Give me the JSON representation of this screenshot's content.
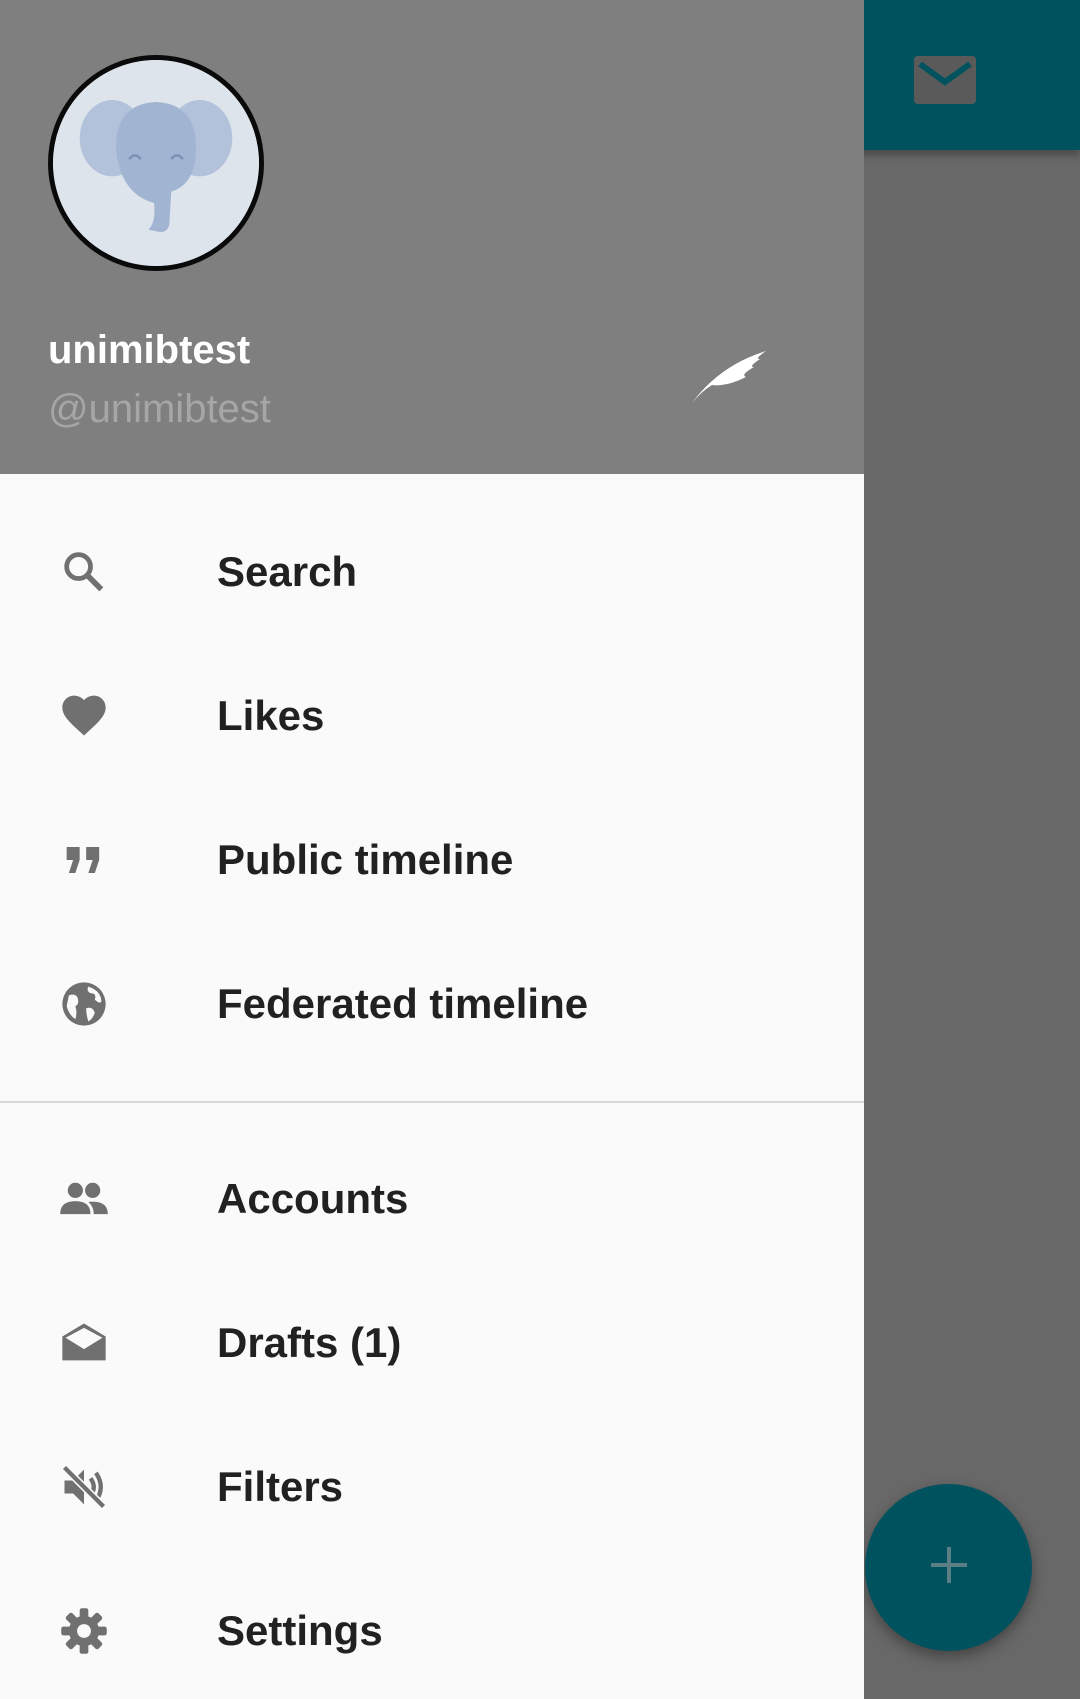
{
  "background": {
    "toolbar_color": "#01525f",
    "mail_icon": "mail-icon",
    "fab_icon": "plus-icon"
  },
  "drawer": {
    "header": {
      "background_color": "#7f7f7f",
      "display_name": "unimibtest",
      "handle": "@unimibtest",
      "avatar_icon": "elephant-avatar",
      "edit_icon": "quill-icon"
    },
    "menu_primary": [
      {
        "icon": "search-icon",
        "label": "Search"
      },
      {
        "icon": "heart-icon",
        "label": "Likes"
      },
      {
        "icon": "quote-icon",
        "label": "Public timeline"
      },
      {
        "icon": "globe-icon",
        "label": "Federated timeline"
      }
    ],
    "menu_secondary": [
      {
        "icon": "people-icon",
        "label": "Accounts"
      },
      {
        "icon": "drafts-icon",
        "label": "Drafts (1)"
      },
      {
        "icon": "volume-off-icon",
        "label": "Filters"
      },
      {
        "icon": "settings-icon",
        "label": "Settings"
      }
    ]
  }
}
